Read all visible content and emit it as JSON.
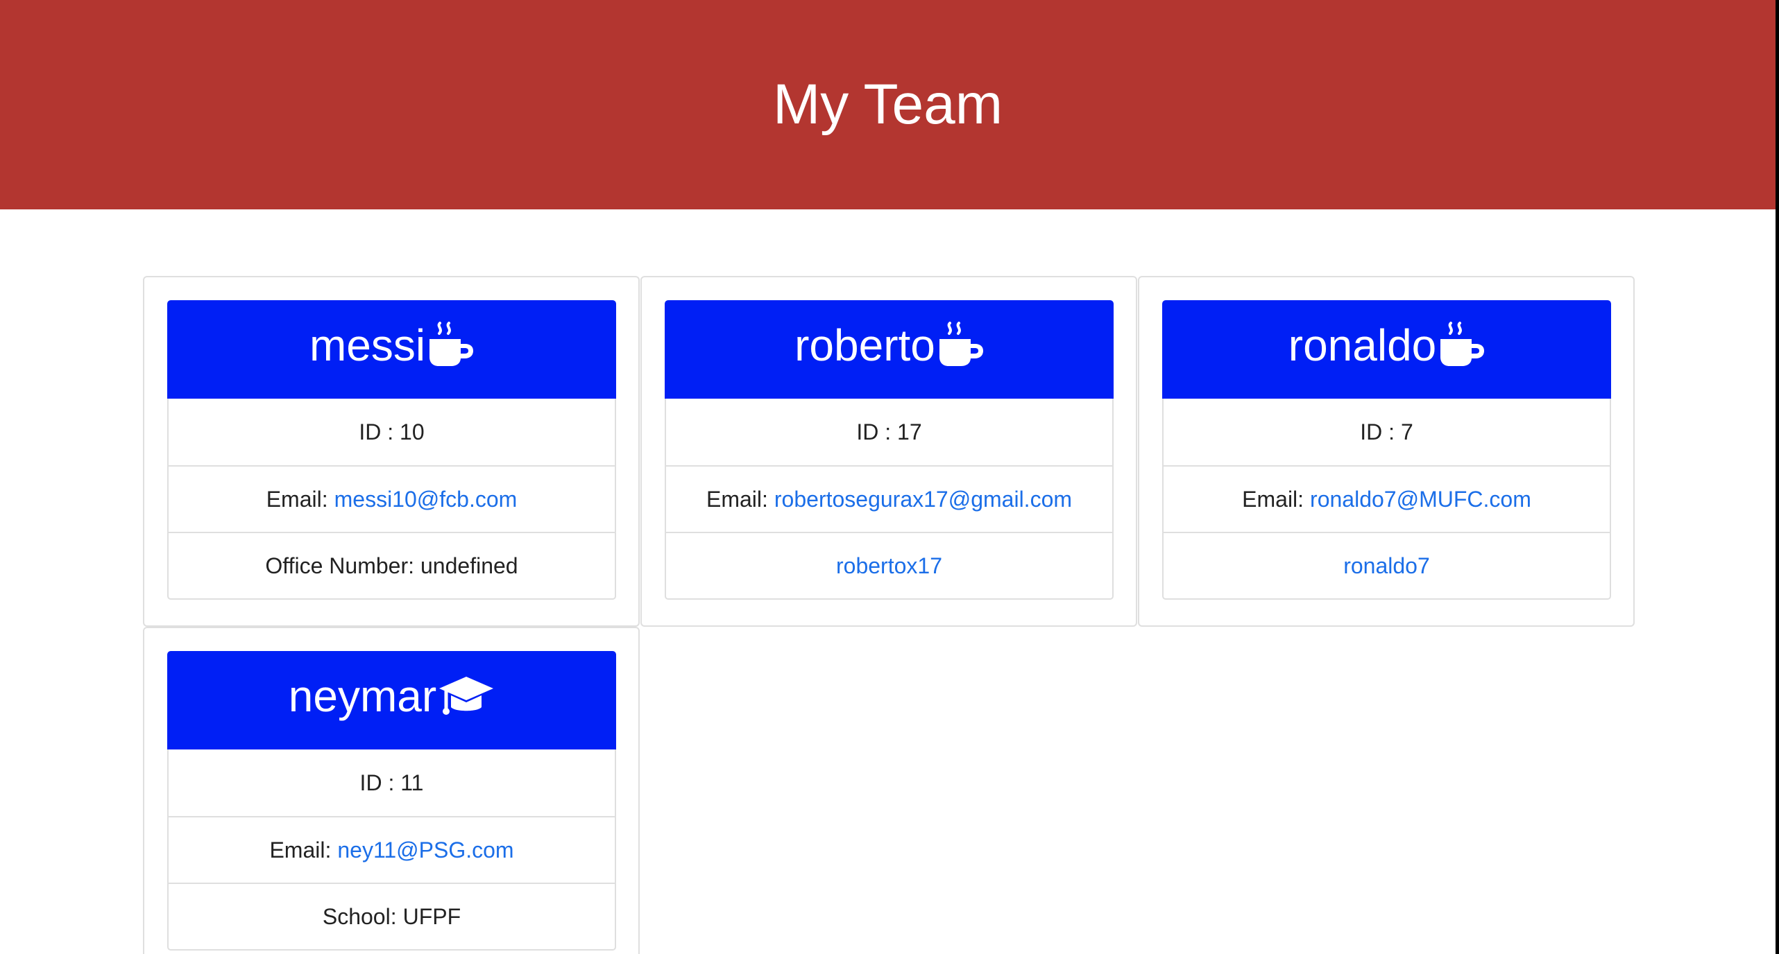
{
  "header": {
    "title": "My Team"
  },
  "colors": {
    "header_background": "#b33630",
    "card_header_background": "#001ff5",
    "link": "#1b6ee8"
  },
  "team": [
    {
      "name": "messi",
      "role_icon": "coffee-icon",
      "id_label": "ID : 10",
      "email_label": "Email:",
      "email": "messi10@fcb.com",
      "extra_label": "Office Number:",
      "extra_value": "undefined"
    },
    {
      "name": "roberto",
      "role_icon": "coffee-icon",
      "id_label": "ID : 17",
      "email_label": "Email:",
      "email": "robertosegurax17@gmail.com",
      "extra_link": "robertox17"
    },
    {
      "name": "ronaldo",
      "role_icon": "coffee-icon",
      "id_label": "ID : 7",
      "email_label": "Email:",
      "email": "ronaldo7@MUFC.com",
      "extra_link": "ronaldo7"
    },
    {
      "name": "neymar",
      "role_icon": "graduation-cap-icon",
      "id_label": "ID : 11",
      "email_label": "Email:",
      "email": "ney11@PSG.com",
      "extra_label": "School:",
      "extra_value": "UFPF"
    }
  ]
}
